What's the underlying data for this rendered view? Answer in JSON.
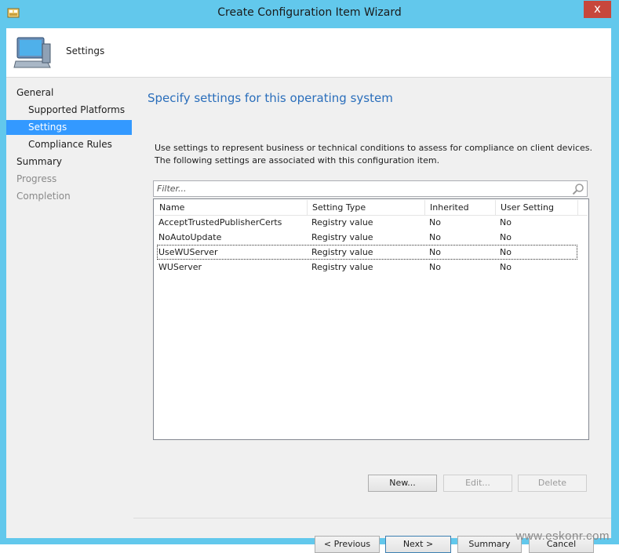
{
  "window": {
    "title": "Create Configuration Item Wizard",
    "close_glyph": "x"
  },
  "header": {
    "label": "Settings"
  },
  "nav": {
    "items": [
      {
        "label": "General"
      },
      {
        "label": "Supported Platforms"
      },
      {
        "label": "Settings"
      },
      {
        "label": "Compliance Rules"
      },
      {
        "label": "Summary"
      },
      {
        "label": "Progress"
      },
      {
        "label": "Completion"
      }
    ]
  },
  "main": {
    "title": "Specify settings for this operating system",
    "description_line1": "Use settings to represent business or technical conditions to assess for compliance on client devices.",
    "description_line2": "The following settings are associated with this configuration item.",
    "filter_placeholder": "Filter..."
  },
  "grid": {
    "columns": [
      "Name",
      "Setting Type",
      "Inherited",
      "User Setting"
    ],
    "rows": [
      [
        "AcceptTrustedPublisherCerts",
        "Registry value",
        "No",
        "No"
      ],
      [
        "NoAutoUpdate",
        "Registry value",
        "No",
        "No"
      ],
      [
        "UseWUServer",
        "Registry value",
        "No",
        "No"
      ],
      [
        "WUServer",
        "Registry value",
        "No",
        "No"
      ]
    ]
  },
  "grid_buttons": {
    "new": "New...",
    "edit": "Edit...",
    "delete": "Delete"
  },
  "footer": {
    "previous": "< Previous",
    "next": "Next >",
    "summary": "Summary",
    "cancel": "Cancel"
  },
  "watermark": "www.eskonr.com",
  "colors": {
    "accent": "#3399ff",
    "title_blue": "#2a6ebb",
    "frame": "#62c8ec"
  }
}
